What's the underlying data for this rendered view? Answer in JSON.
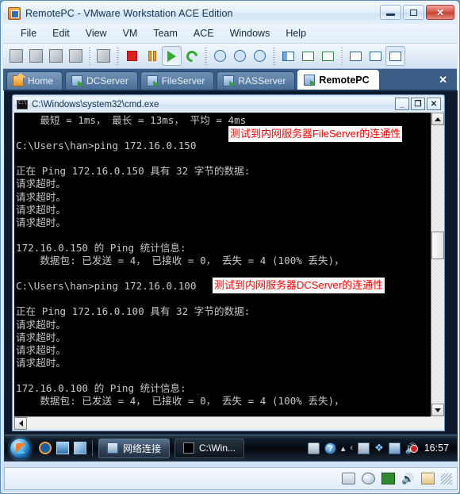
{
  "window": {
    "title": "RemotePC - VMware Workstation ACE Edition",
    "icon": "vmware-icon",
    "controls": {
      "minimize": "minimize-icon",
      "maximize": "maximize-icon",
      "close": "✕"
    }
  },
  "menu": [
    "File",
    "Edit",
    "View",
    "VM",
    "Team",
    "ACE",
    "Windows",
    "Help"
  ],
  "toolbar": {
    "groups": [
      [
        "power-on-icon",
        "power-off-icon",
        "suspend-icon",
        "snapshot-manager-icon"
      ],
      [
        "capture-icon"
      ],
      [
        "stop-icon",
        "pause-icon",
        "play-icon",
        "reset-icon"
      ],
      [
        "take-snapshot-icon",
        "revert-snapshot-icon",
        "manage-snapshots-icon"
      ],
      [
        "show-sidebar-icon",
        "fullscreen-icon",
        "quick-switch-icon"
      ],
      [
        "settings-icon",
        "summary-icon",
        "console-view-icon"
      ]
    ]
  },
  "tabs": [
    {
      "label": "Home",
      "icon": "home-icon",
      "active": false
    },
    {
      "label": "DCServer",
      "icon": "vm-icon",
      "active": false
    },
    {
      "label": "FileServer",
      "icon": "vm-icon",
      "active": false
    },
    {
      "label": "RASServer",
      "icon": "vm-icon",
      "active": false
    },
    {
      "label": "RemotePC",
      "icon": "vm-icon",
      "active": true
    }
  ],
  "tab_close_label": "✕",
  "cmd_window": {
    "title": "C:\\Windows\\system32\\cmd.exe",
    "icon": "cmd-icon",
    "controls": {
      "minimize": "_",
      "maximize": "❐",
      "close": "✕"
    },
    "console_lines": [
      "    最短 = 1ms， 最长 = 13ms， 平均 = 4ms",
      "",
      "C:\\Users\\han>ping 172.16.0.150",
      "",
      "正在 Ping 172.16.0.150 具有 32 字节的数据:",
      "请求超时。",
      "请求超时。",
      "请求超时。",
      "请求超时。",
      "",
      "172.16.0.150 的 Ping 统计信息:",
      "    数据包: 已发送 = 4， 已接收 = 0， 丢失 = 4 (100% 丢失)，",
      "",
      "C:\\Users\\han>ping 172.16.0.100",
      "",
      "正在 Ping 172.16.0.100 具有 32 字节的数据:",
      "请求超时。",
      "请求超时。",
      "请求超时。",
      "请求超时。",
      "",
      "172.16.0.100 的 Ping 统计信息:",
      "    数据包: 已发送 = 4， 已接收 = 0， 丢失 = 4 (100% 丢失)，",
      "",
      "C:\\Users\\han>"
    ]
  },
  "annotations": [
    {
      "text": "测试到内网服务器FileServer的连通性",
      "color": "#ff0000"
    },
    {
      "text": "测试到内网服务器DCServer的连通性",
      "color": "#ff0000"
    }
  ],
  "guest_taskbar": {
    "start": "start-orb-icon",
    "quicklaunch": [
      "internet-explorer-icon",
      "show-desktop-icon",
      "flip-3d-icon"
    ],
    "tasks": [
      {
        "label": "网络连接",
        "icon": "network-connections-icon",
        "active": false
      },
      {
        "label": "C:\\Win...",
        "icon": "cmd-icon",
        "active": true
      }
    ],
    "tray": [
      "keyboard-icon",
      "help-icon",
      "chevron-up-icon",
      "expand-tray-icon",
      "action-center-icon",
      "vmware-tools-icon",
      "network-icon",
      "volume-muted-icon"
    ],
    "clock": "16:57"
  },
  "status_bar": {
    "devices": [
      "hard-disk-icon",
      "cd-drive-icon",
      "network-adapter-icon",
      "sound-icon",
      "notes-icon"
    ],
    "grip": "resize-grip-icon"
  }
}
